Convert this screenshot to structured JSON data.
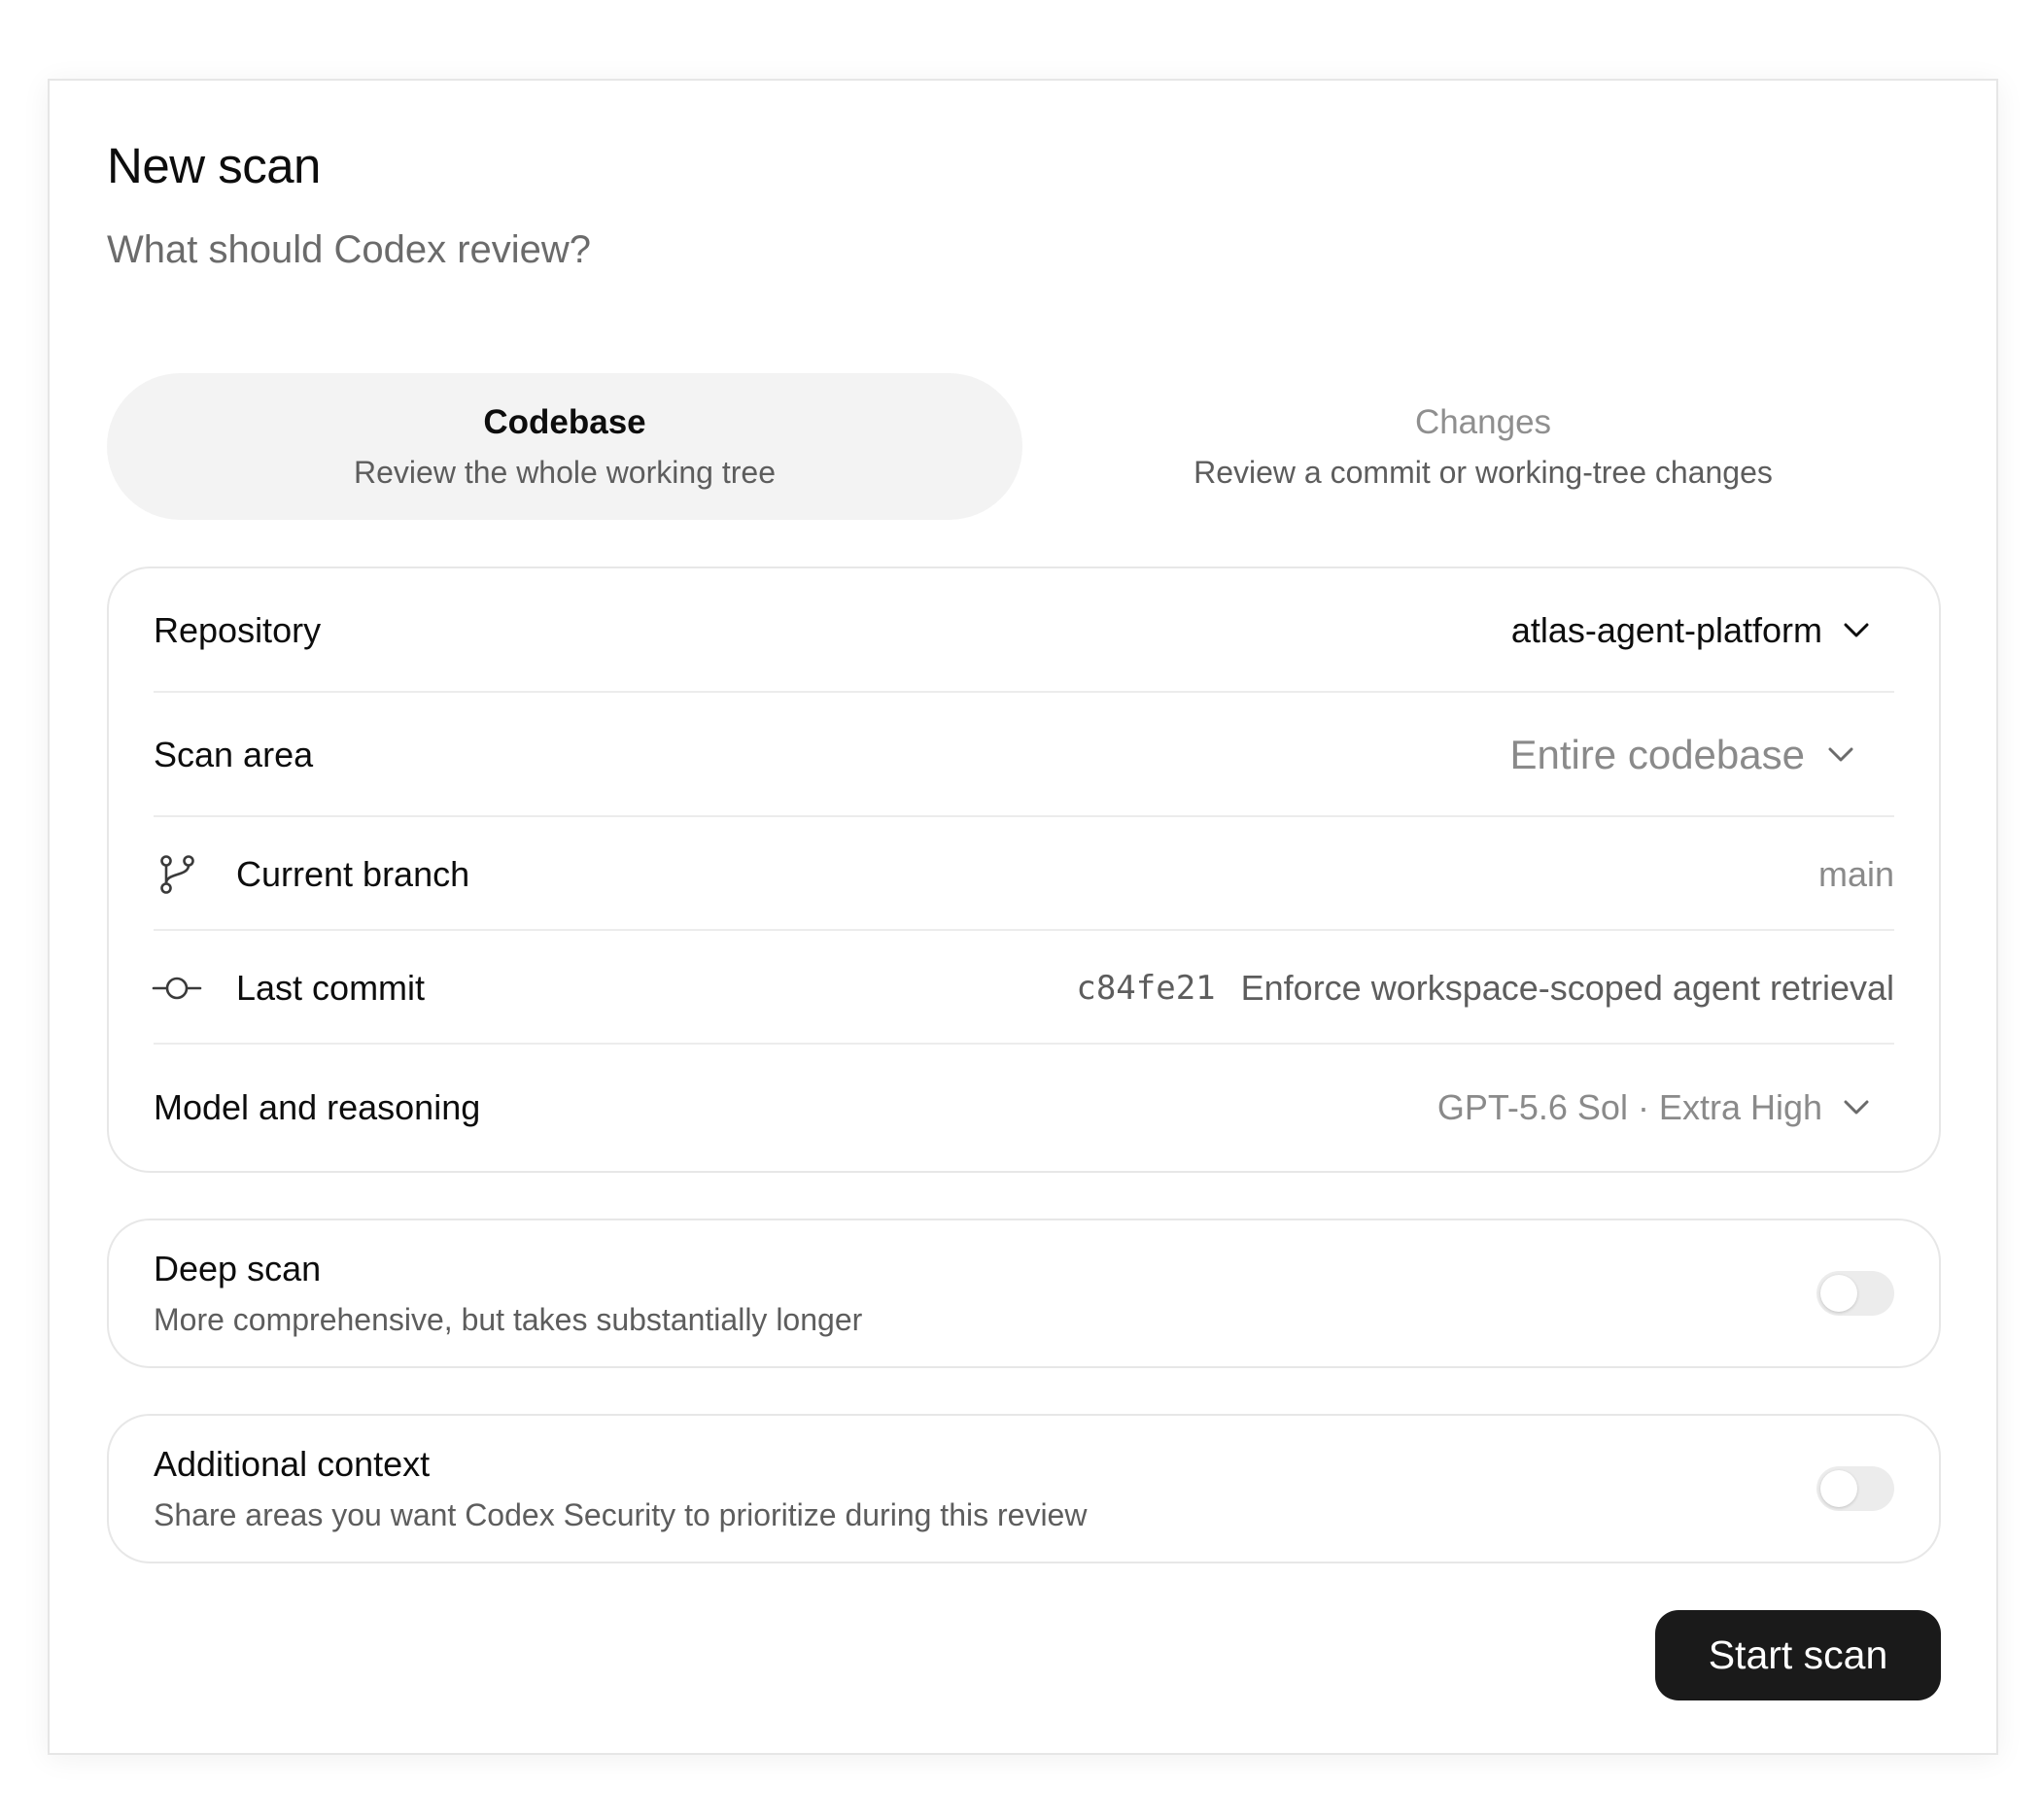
{
  "header": {
    "title": "New scan",
    "subtitle": "What should Codex review?"
  },
  "tabs": [
    {
      "title": "Codebase",
      "description": "Review the whole working tree",
      "active": true
    },
    {
      "title": "Changes",
      "description": "Review a commit or working-tree changes",
      "active": false
    }
  ],
  "settings": {
    "repository": {
      "label": "Repository",
      "value": "atlas-agent-platform"
    },
    "scan_area": {
      "label": "Scan area",
      "value": "Entire codebase"
    },
    "branch": {
      "label": "Current branch",
      "value": "main",
      "icon": "git-branch-icon"
    },
    "commit": {
      "label": "Last commit",
      "hash": "c84fe21",
      "message": "Enforce workspace-scoped agent retrieval",
      "icon": "git-commit-icon"
    },
    "model": {
      "label": "Model and reasoning",
      "value": "GPT-5.6 Sol · Extra High"
    }
  },
  "deep_scan": {
    "title": "Deep scan",
    "description": "More comprehensive, but takes substantially longer",
    "enabled": false
  },
  "additional_context": {
    "title": "Additional context",
    "description": "Share areas you want Codex Security to prioritize during this review",
    "enabled": false
  },
  "actions": {
    "start_label": "Start scan"
  },
  "colors": {
    "primary_button": "#1a1a1a",
    "active_tab_bg": "#f3f3f3",
    "muted_text": "#8a8a8a",
    "border": "#e7e7e7"
  }
}
